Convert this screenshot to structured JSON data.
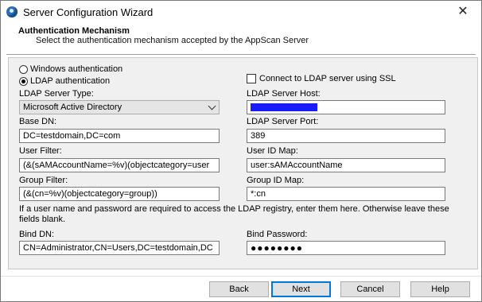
{
  "window": {
    "title": "Server Configuration Wizard",
    "close_glyph": "✕"
  },
  "header": {
    "title": "Authentication Mechanism",
    "subtitle": "Select the authentication mechanism accepted by the AppScan Server"
  },
  "auth": {
    "windows_label": "Windows authentication",
    "ldap_label": "LDAP authentication",
    "selected": "ldap",
    "ssl_label": "Connect to LDAP server using SSL",
    "ssl_checked": false
  },
  "fields": {
    "server_type": {
      "label": "LDAP Server Type:",
      "value": "Microsoft Active Directory"
    },
    "server_host": {
      "label": "LDAP Server Host:",
      "value": "",
      "redacted": true
    },
    "base_dn": {
      "label": "Base DN:",
      "value": "DC=testdomain,DC=com"
    },
    "server_port": {
      "label": "LDAP Server Port:",
      "value": "389"
    },
    "user_filter": {
      "label": "User Filter:",
      "value": "(&(sAMAccountName=%v)(objectcategory=user"
    },
    "user_id_map": {
      "label": "User ID Map:",
      "value": "user:sAMAccountName"
    },
    "group_filter": {
      "label": "Group Filter:",
      "value": "(&(cn=%v)(objectcategory=group))"
    },
    "group_id_map": {
      "label": "Group ID Map:",
      "value": "*:cn"
    },
    "bind_dn": {
      "label": "Bind DN:",
      "value": "CN=Administrator,CN=Users,DC=testdomain,DC"
    },
    "bind_password": {
      "label": "Bind Password:",
      "value": "●●●●●●●●"
    }
  },
  "info_text": "If a user name and password are required to access the LDAP registry, enter them here. Otherwise leave these fields blank.",
  "buttons": {
    "back": "Back",
    "next": "Next",
    "cancel": "Cancel",
    "help": "Help"
  }
}
